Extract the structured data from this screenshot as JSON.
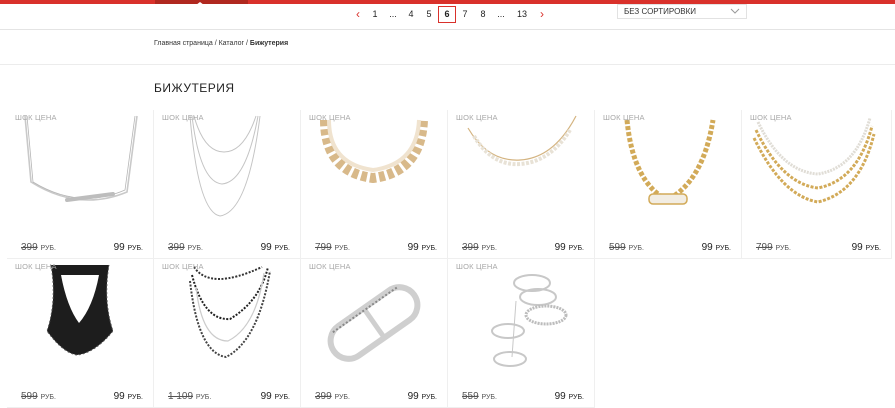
{
  "pagination": {
    "prev": "‹",
    "next": "›",
    "pages": [
      "1",
      "...",
      "4",
      "5",
      "6",
      "7",
      "8",
      "...",
      "13"
    ],
    "active": "6"
  },
  "sort": {
    "label": "БЕЗ СОРТИРОВКИ",
    "icon": "chevron-down-icon"
  },
  "breadcrumb": {
    "home": "Главная страница",
    "sep1": " / ",
    "catalog": "Каталог",
    "sep2": " / ",
    "current": "Бижутерия"
  },
  "page_title": "БИЖУТЕРИЯ",
  "products": [
    {
      "badge": "ШОК ЦЕНА",
      "old_price": "399",
      "new_price": "99",
      "currency": "РУБ.",
      "image": "silver-bar-necklace"
    },
    {
      "badge": "ШОК ЦЕНА",
      "old_price": "399",
      "new_price": "99",
      "currency": "РУБ.",
      "image": "silver-layered-necklace"
    },
    {
      "badge": "ШОК ЦЕНА",
      "old_price": "799",
      "new_price": "99",
      "currency": "РУБ.",
      "image": "gold-plate-necklace"
    },
    {
      "badge": "ШОК ЦЕНА",
      "old_price": "399",
      "new_price": "99",
      "currency": "РУБ.",
      "image": "gold-pearl-necklace"
    },
    {
      "badge": "ШОК ЦЕНА",
      "old_price": "599",
      "new_price": "99",
      "currency": "РУБ.",
      "image": "gold-chain-necklace"
    },
    {
      "badge": "ШОК ЦЕНА",
      "old_price": "799",
      "new_price": "99",
      "currency": "РУБ.",
      "image": "gold-multichain-necklace"
    },
    {
      "badge": "ШОК ЦЕНА",
      "old_price": "599",
      "new_price": "99",
      "currency": "РУБ.",
      "image": "black-bead-bib-necklace"
    },
    {
      "badge": "ШОК ЦЕНА",
      "old_price": "1 109",
      "new_price": "99",
      "currency": "РУБ.",
      "image": "black-bead-layered-necklace"
    },
    {
      "badge": "ШОК ЦЕНА",
      "old_price": "399",
      "new_price": "99",
      "currency": "РУБ.",
      "image": "double-finger-ring"
    },
    {
      "badge": "ШОК ЦЕНА",
      "old_price": "559",
      "new_price": "99",
      "currency": "РУБ.",
      "image": "silver-midi-rings-set"
    }
  ]
}
